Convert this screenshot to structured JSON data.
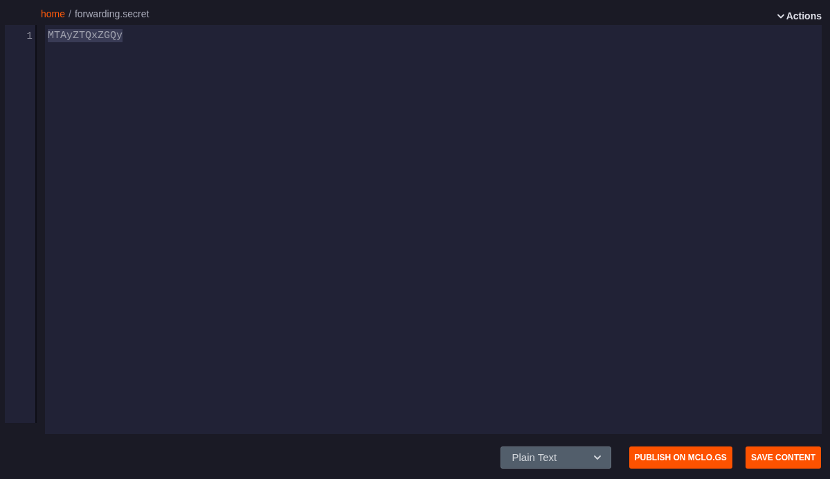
{
  "breadcrumb": {
    "separator": "/",
    "items": [
      {
        "label": "home",
        "kind": "link"
      },
      {
        "label": "forwarding.secret",
        "kind": "current"
      }
    ]
  },
  "actions_menu": {
    "label": "Actions"
  },
  "editor": {
    "lines": [
      {
        "number": "1",
        "text": "MTAyZTQxZGQy",
        "selected": true
      }
    ]
  },
  "language_select": {
    "value": "Plain Text"
  },
  "buttons": [
    {
      "label": "PUBLISH ON MCLO.GS"
    },
    {
      "label": "SAVE CONTENT"
    }
  ]
}
